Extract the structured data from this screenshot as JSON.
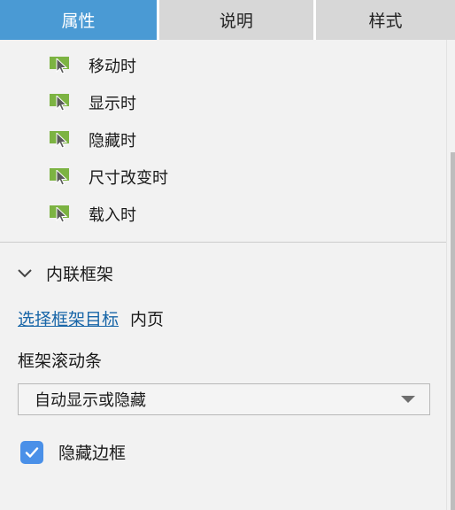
{
  "tabs": [
    {
      "label": "属性",
      "active": true
    },
    {
      "label": "说明",
      "active": false
    },
    {
      "label": "样式",
      "active": false
    }
  ],
  "events": {
    "items": [
      {
        "label": "移动时",
        "icon": "event-cursor-icon"
      },
      {
        "label": "显示时",
        "icon": "event-cursor-icon"
      },
      {
        "label": "隐藏时",
        "icon": "event-cursor-icon"
      },
      {
        "label": "尺寸改变时",
        "icon": "event-cursor-icon"
      },
      {
        "label": "载入时",
        "icon": "event-cursor-icon"
      }
    ]
  },
  "iframe_section": {
    "expand_icon": "chevron-down-icon",
    "title": "内联框架",
    "target_link": "选择框架目标",
    "target_value": "内页",
    "scrollbar_label": "框架滚动条",
    "scrollbar_value": "自动显示或隐藏",
    "scrollbar_options": [
      "自动显示或隐藏"
    ],
    "dropdown_icon": "chevron-down-icon",
    "hide_border_label": "隐藏边框",
    "hide_border_checked": true
  },
  "colors": {
    "active_tab": "#4a9ad4",
    "inactive_tab": "#d7d7d7",
    "link": "#1866a8",
    "checkbox": "#4a90e8",
    "event_icon": "#7cb342",
    "background": "#f2f2f2"
  }
}
